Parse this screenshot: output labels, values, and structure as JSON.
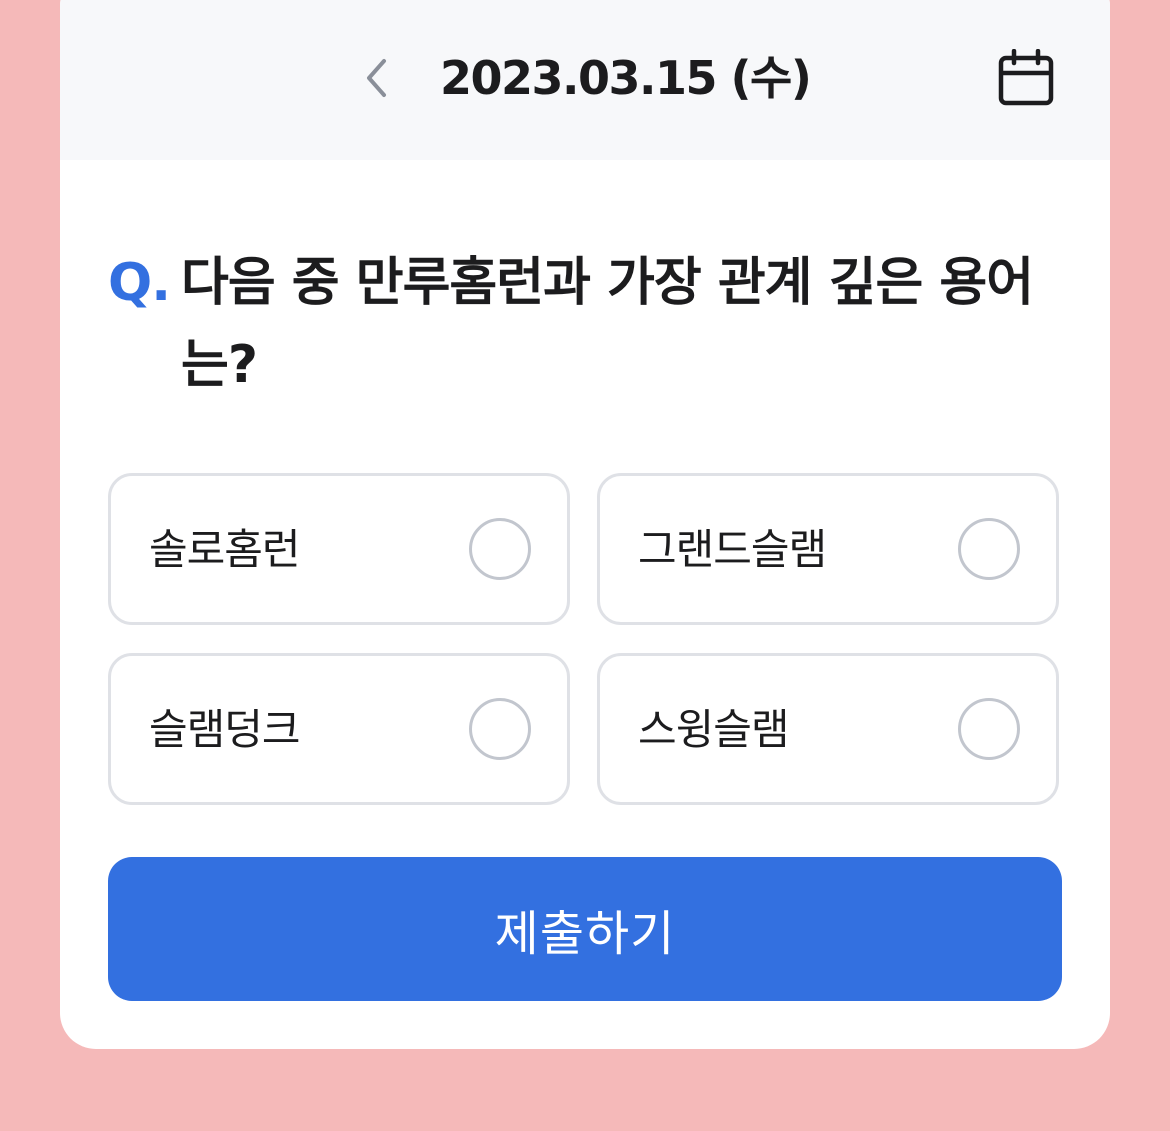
{
  "header": {
    "date": "2023.03.15 (수)",
    "prev_icon": "chevron-left-icon",
    "calendar_icon": "calendar-icon"
  },
  "question": {
    "prefix": "Q.",
    "text": "다음 중 만루홈런과 가장 관계 깊은 용어는?"
  },
  "options": [
    {
      "label": "솔로홈런",
      "selected": false
    },
    {
      "label": "그랜드슬램",
      "selected": false
    },
    {
      "label": "슬램덩크",
      "selected": false
    },
    {
      "label": "스윙슬램",
      "selected": false
    }
  ],
  "submit": {
    "label": "제출하기"
  },
  "colors": {
    "background": "#f5b9b9",
    "accent": "#3370e0",
    "header_bg": "#f7f8fa",
    "option_border": "#dfe1e6",
    "radio_border": "#c2c6ce",
    "text": "#1c1c1e"
  }
}
